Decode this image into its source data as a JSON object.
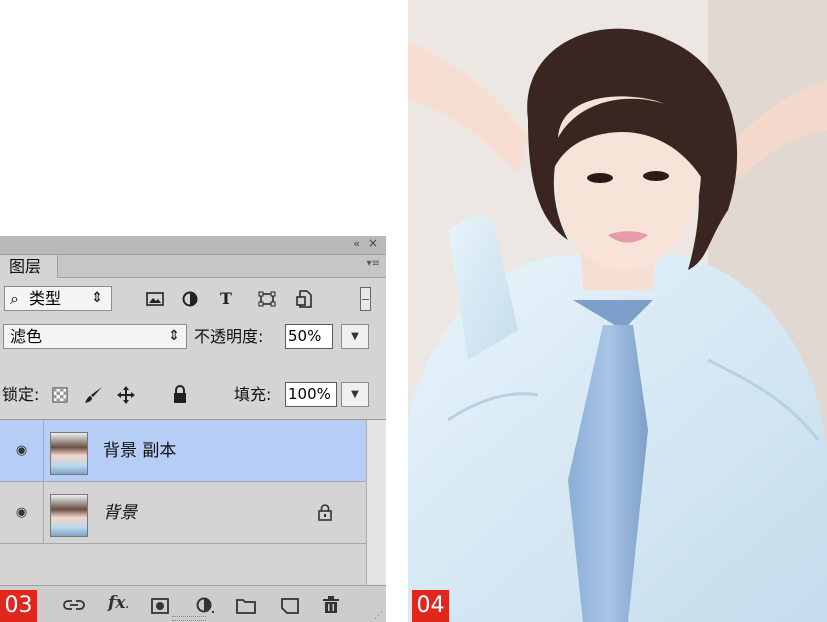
{
  "panel": {
    "collapse_icon": "«",
    "close_icon": "×",
    "tab": "图层",
    "menu_icon": "▾≡",
    "filter": {
      "search_icon": "⌕",
      "kind": "类型",
      "arrows": "⇕"
    },
    "filter_icons": [
      "image-filter-icon",
      "adjustment-filter-icon",
      "type-filter-icon",
      "shape-filter-icon",
      "smart-object-filter-icon"
    ],
    "blend_mode": "滤色",
    "opacity_label": "不透明度:",
    "opacity_value": "50%",
    "lock_label": "锁定:",
    "fill_label": "填充:",
    "fill_value": "100%",
    "layers": [
      {
        "name": "背景 副本",
        "selected": true
      },
      {
        "name": "背景",
        "locked": true
      }
    ],
    "footer_icons": [
      "link-icon",
      "fx-icon",
      "mask-icon",
      "adjustment-layer-icon",
      "folder-icon",
      "new-layer-icon",
      "trash-icon"
    ]
  },
  "badges": {
    "left": "03",
    "right": "04"
  }
}
